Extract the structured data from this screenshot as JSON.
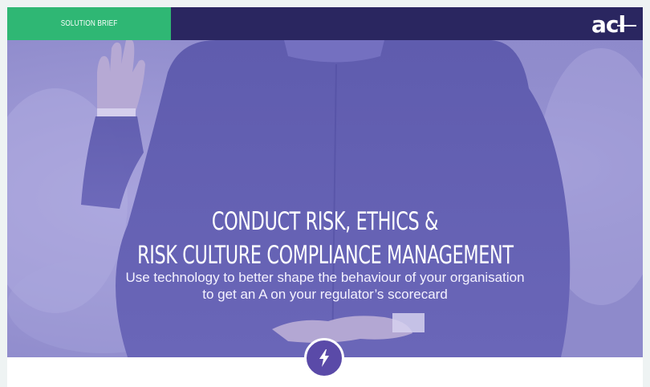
{
  "header": {
    "tag_label": "SOLUTION BRIEF",
    "logo_text": "acl",
    "bar_color": "#2a2660",
    "tag_color": "#2fb774"
  },
  "hero": {
    "title_line1": "CONDUCT RISK, ETHICS &",
    "title_line2": "RISK CULTURE COMPLIANCE MANAGEMENT",
    "subtitle_line1": "Use technology to better shape the behaviour of your organisation",
    "subtitle_line2": "to get an A on your regulator’s scorecard",
    "overlay_color": "#8e8acb",
    "image_subject": "businessman-crossed-fingers-behind-back"
  },
  "badge": {
    "icon": "lightning-icon",
    "color": "#5a4aa8"
  }
}
